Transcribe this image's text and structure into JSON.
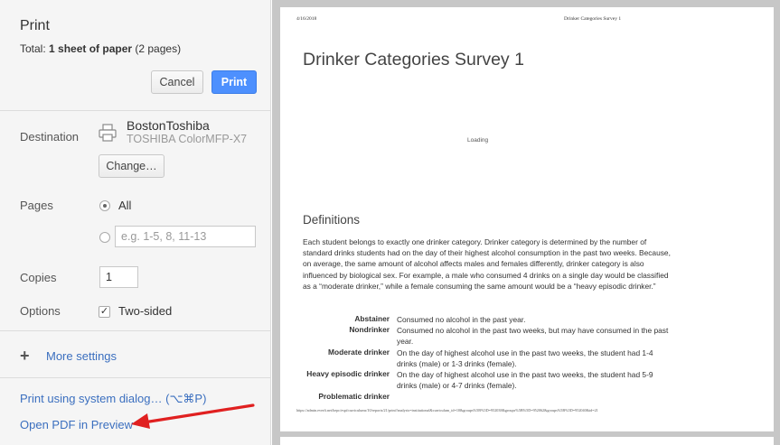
{
  "dialog": {
    "title": "Print",
    "total_prefix": "Total: ",
    "total_bold": "1 sheet of paper",
    "total_suffix": " (2 pages)",
    "cancel_label": "Cancel",
    "print_label": "Print"
  },
  "destination": {
    "label": "Destination",
    "printer_name": "BostonToshiba",
    "printer_model": "TOSHIBA ColorMFP-X7",
    "change_label": "Change…"
  },
  "pages": {
    "label": "Pages",
    "all_label": "All",
    "selected": "All",
    "custom_placeholder": "e.g. 1-5, 8, 11-13"
  },
  "copies": {
    "label": "Copies",
    "value": "1"
  },
  "options": {
    "label": "Options",
    "two_sided_label": "Two-sided",
    "two_sided_checked": true
  },
  "more_settings": {
    "label": "More settings"
  },
  "links": {
    "system_dialog": "Print using system dialog… (⌥⌘P)",
    "open_pdf": "Open PDF in Preview"
  },
  "preview": {
    "date": "4/16/2018",
    "header": "Drinker Categories Survey 1",
    "title": "Drinker Categories Survey 1",
    "loading": "Loading",
    "section_title": "Definitions",
    "paragraph": "Each student belongs to exactly one drinker category. Drinker category is determined by the number of standard drinks students had on the day of their highest alcohol consumption in the past two weeks. Because, on average, the same amount of alcohol affects males and females differently, drinker category is also influenced by biological sex. For example, a male who consumed 4 drinks on a single day would be classified as a “moderate drinker,” while a female consuming the same amount would be a “heavy episodic drinker.”",
    "definitions": [
      {
        "term": "Abstainer",
        "desc": "Consumed no alcohol in the past year."
      },
      {
        "term": "Nondrinker",
        "desc": "Consumed no alcohol in the past two weeks, but may have consumed in the past year."
      },
      {
        "term": "Moderate drinker",
        "desc": "On the day of highest alcohol use in the past two weeks, the student had 1-4 drinks (male) or 1-3 drinks (female)."
      },
      {
        "term": "Heavy episodic drinker",
        "desc": "On the day of highest alcohol use in the past two weeks, the student had 5-9 drinks (male) or 4-7 drinks (female)."
      },
      {
        "term": "Problematic drinker",
        "desc": ""
      }
    ],
    "footer_url": "https://admin.everfi.net/hepc/espi/curriculums/10/reports/21/print?analysis=institutional&curriculum_id=10&groups%5B%5D=952038&groups%5B%5D=952062&groups%5B%5D=952040&id=21"
  },
  "colors": {
    "accent": "#4d90fe",
    "link": "#3b6fbf",
    "annotation_arrow": "#e02020"
  }
}
